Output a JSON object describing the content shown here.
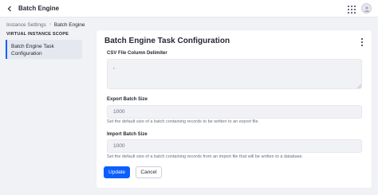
{
  "header": {
    "title": "Batch Engine",
    "back_icon": "chevron-left-icon",
    "apps_icon": "grid-icon",
    "user_icon": "avatar"
  },
  "breadcrumb": {
    "items": [
      "Instance Settings",
      "Batch Engine"
    ]
  },
  "sidebar": {
    "heading": "VIRTUAL INSTANCE SCOPE",
    "items": [
      {
        "label": "Batch Engine Task Configuration",
        "active": true
      }
    ]
  },
  "main": {
    "title": "Batch Engine Task Configuration",
    "csv_delimiter": {
      "label": "CSV File Column Delimiter",
      "value": ","
    },
    "export_batch_size": {
      "label": "Export Batch Size",
      "value": "1000",
      "help": "Set the default size of a batch containing records to be written to an export file."
    },
    "import_batch_size": {
      "label": "Import Batch Size",
      "value": "1000",
      "help": "Set the default size of a batch containing records from an import file that will be written to a database."
    },
    "buttons": {
      "update": "Update",
      "cancel": "Cancel"
    }
  },
  "colors": {
    "primary": "#0b5fff",
    "background": "#f1f2f5",
    "text": "#272833",
    "muted": "#6b6c7e"
  }
}
